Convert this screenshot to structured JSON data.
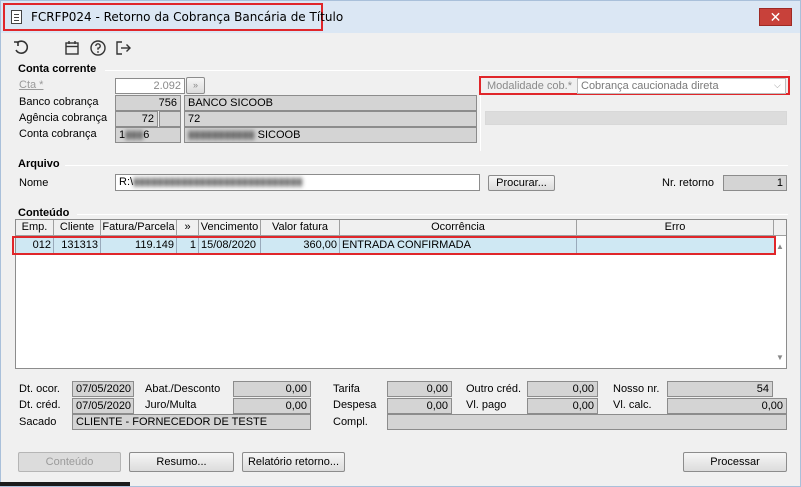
{
  "window": {
    "title": "FCRFP024 - Retorno da Cobrança Bancária de Título",
    "close_label": "✕"
  },
  "toolbar": {
    "icons": [
      "undo-icon",
      "calendar-icon",
      "help-icon",
      "exit-icon"
    ]
  },
  "conta_corrente": {
    "section_title": "Conta corrente",
    "cta_label": "Cta *",
    "cta_value": "2.092",
    "banco_label": "Banco cobrança",
    "banco_code": "756",
    "banco_name": "BANCO SICOOB",
    "agencia_label": "Agência cobrança",
    "agencia_code": "72",
    "agencia_digit": "",
    "agencia_name": "72",
    "conta_label": "Conta cobrança",
    "conta_code": "1",
    "conta_code_tail": "6",
    "conta_name": "SICOOB",
    "modalidade_label": "Modalidade cob.*",
    "modalidade_value": "Cobrança caucionada direta"
  },
  "arquivo": {
    "section_title": "Arquivo",
    "nome_label": "Nome",
    "nome_value": "R:\\",
    "procurar_label": "Procurar...",
    "nr_retorno_label": "Nr. retorno",
    "nr_retorno_value": "1"
  },
  "conteudo": {
    "section_title": "Conteúdo",
    "columns": [
      "Emp.",
      "Cliente",
      "Fatura/Parcela",
      "»",
      "Vencimento",
      "Valor fatura",
      "Ocorrência",
      "Erro"
    ],
    "rows": [
      {
        "emp": "012",
        "cliente": "131313",
        "fatura": "119.149",
        "parcela": "1",
        "vencimento": "15/08/2020",
        "valor": "360,00",
        "ocorrencia": "ENTRADA CONFIRMADA",
        "erro": ""
      }
    ]
  },
  "details": {
    "dt_ocor_label": "Dt. ocor.",
    "dt_ocor_value": "07/05/2020",
    "dt_cred_label": "Dt. créd.",
    "dt_cred_value": "07/05/2020",
    "sacado_label": "Sacado",
    "sacado_value": "CLIENTE - FORNECEDOR DE TESTE",
    "abat_label": "Abat./Desconto",
    "abat_value": "0,00",
    "juro_label": "Juro/Multa",
    "juro_value": "0,00",
    "tarifa_label": "Tarifa",
    "tarifa_value": "0,00",
    "despesa_label": "Despesa",
    "despesa_value": "0,00",
    "compl_label": "Compl.",
    "compl_value": "",
    "outro_label": "Outro créd.",
    "outro_value": "0,00",
    "vlpago_label": "Vl. pago",
    "vlpago_value": "0,00",
    "nosso_label": "Nosso nr.",
    "nosso_value": "54",
    "vlcalc_label": "Vl. calc.",
    "vlcalc_value": "0,00"
  },
  "buttons": {
    "conteudo": "Conteúdo",
    "resumo": "Resumo...",
    "relatorio": "Relatório retorno...",
    "processar": "Processar"
  }
}
